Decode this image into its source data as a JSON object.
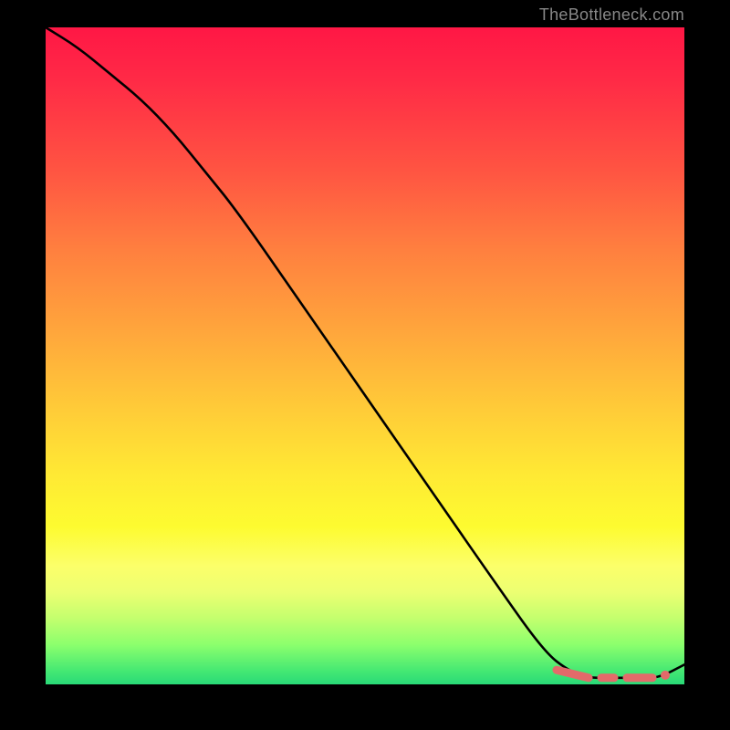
{
  "attribution": "TheBottleneck.com",
  "chart_data": {
    "type": "line",
    "title": "",
    "xlabel": "",
    "ylabel": "",
    "xlim": [
      0,
      100
    ],
    "ylim": [
      0,
      100
    ],
    "series": [
      {
        "name": "curve",
        "x": [
          0,
          5,
          10,
          15,
          20,
          25,
          30,
          40,
          50,
          60,
          70,
          78,
          82,
          85,
          88,
          90,
          93,
          96,
          100
        ],
        "y": [
          100,
          97,
          93,
          89,
          84,
          78,
          72,
          58,
          44,
          30,
          16,
          5,
          2,
          1,
          1,
          1,
          1,
          1,
          3
        ]
      }
    ],
    "highlight_segments": [
      {
        "x0": 80,
        "y0": 2.2,
        "x1": 85,
        "y1": 1.0
      },
      {
        "x0": 87,
        "y0": 1.0,
        "x1": 89,
        "y1": 1.0
      },
      {
        "x0": 91,
        "y0": 1.0,
        "x1": 95,
        "y1": 1.0
      }
    ],
    "highlight_point": {
      "x": 97,
      "y": 1.4
    },
    "colors": {
      "line": "#000000",
      "highlight": "#e36a6a",
      "gradient_top": "#ff1745",
      "gradient_mid": "#ffe934",
      "gradient_bottom": "#29d977"
    }
  }
}
